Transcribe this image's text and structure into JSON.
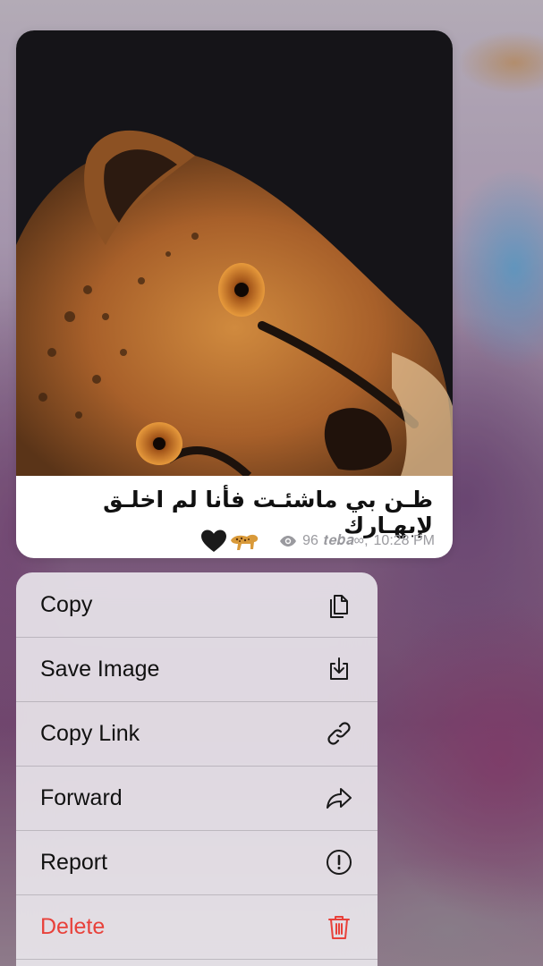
{
  "message": {
    "caption": "ظـن بي ماشئـت فأنا لم اخلـق لإبهـارك",
    "views": "96",
    "author": "𝒕𝒆𝒃𝒂∞",
    "time": "10:28 PM",
    "emoji": [
      "black-heart",
      "leopard"
    ]
  },
  "menu": {
    "items": [
      {
        "label": "Copy",
        "icon": "copy-icon"
      },
      {
        "label": "Save Image",
        "icon": "save-image-icon"
      },
      {
        "label": "Copy Link",
        "icon": "link-icon"
      },
      {
        "label": "Forward",
        "icon": "forward-icon"
      },
      {
        "label": "Report",
        "icon": "report-icon"
      },
      {
        "label": "Delete",
        "icon": "trash-icon"
      }
    ]
  },
  "colors": {
    "destructive": "#e8413a",
    "menu_text": "#111111",
    "meta_text": "#9a9a9f"
  }
}
